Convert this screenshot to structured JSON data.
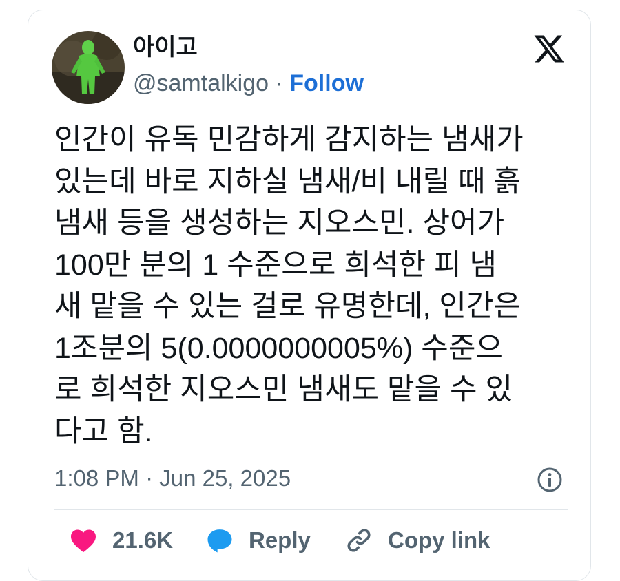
{
  "author": {
    "display_name": "아이고",
    "handle": "@samtalkigo",
    "separator": "·",
    "follow_label": "Follow"
  },
  "post": {
    "text": "인간이 유독 민감하게 감지하는 냄새가\n있는데 바로 지하실 냄새/비 내릴 때 흙\n냄새 등을 생성하는 지오스민. 상어가\n100만 분의 1 수준으로 희석한 피 냄\n새 맡을 수 있는 걸로 유명한데, 인간은\n1조분의 5(0.0000000005%) 수준으\n로 희석한 지오스민 냄새도 맡을 수 있\n다고 함.",
    "timestamp": "1:08 PM · Jun 25, 2025"
  },
  "actions": {
    "like_count": "21.6K",
    "reply_label": "Reply",
    "copy_link_label": "Copy link"
  },
  "colors": {
    "like": "#f91880",
    "reply": "#1d9bf0",
    "follow": "#1d6fd6",
    "secondary_text": "#536471"
  },
  "icons": [
    "avatar",
    "x-logo-icon",
    "info-icon",
    "heart-icon",
    "reply-bubble-icon",
    "link-icon"
  ]
}
